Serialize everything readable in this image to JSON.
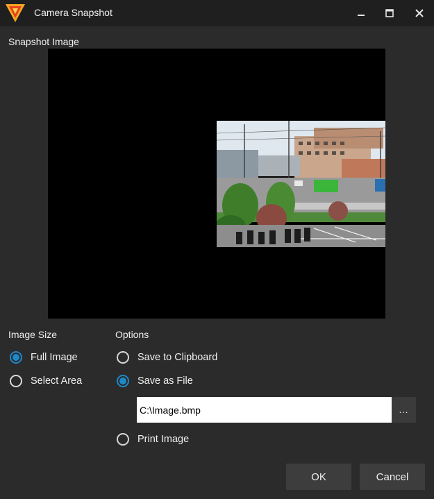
{
  "window": {
    "title": "Camera Snapshot",
    "icons": {
      "app": "app-logo-icon",
      "minimize": "minimize-icon",
      "maximize": "maximize-icon",
      "close": "close-icon"
    }
  },
  "snapshot": {
    "label": "Snapshot Image",
    "image_icon": "street-scene-photo"
  },
  "image_size": {
    "label": "Image Size",
    "options": [
      {
        "label": "Full Image",
        "checked": true
      },
      {
        "label": "Select Area",
        "checked": false
      }
    ]
  },
  "options": {
    "label": "Options",
    "save_clipboard": {
      "label": "Save to Clipboard",
      "checked": false
    },
    "save_file": {
      "label": "Save as File",
      "checked": true
    },
    "file_path": {
      "value": "C:\\Image.bmp"
    },
    "browse_label": "...",
    "print_image": {
      "label": "Print Image",
      "checked": false
    }
  },
  "buttons": {
    "ok": "OK",
    "cancel": "Cancel"
  },
  "colors": {
    "accent": "#1e88c9",
    "background": "#2b2b2b",
    "titlebar": "#1f1f1f",
    "logo": "#f5a623"
  }
}
